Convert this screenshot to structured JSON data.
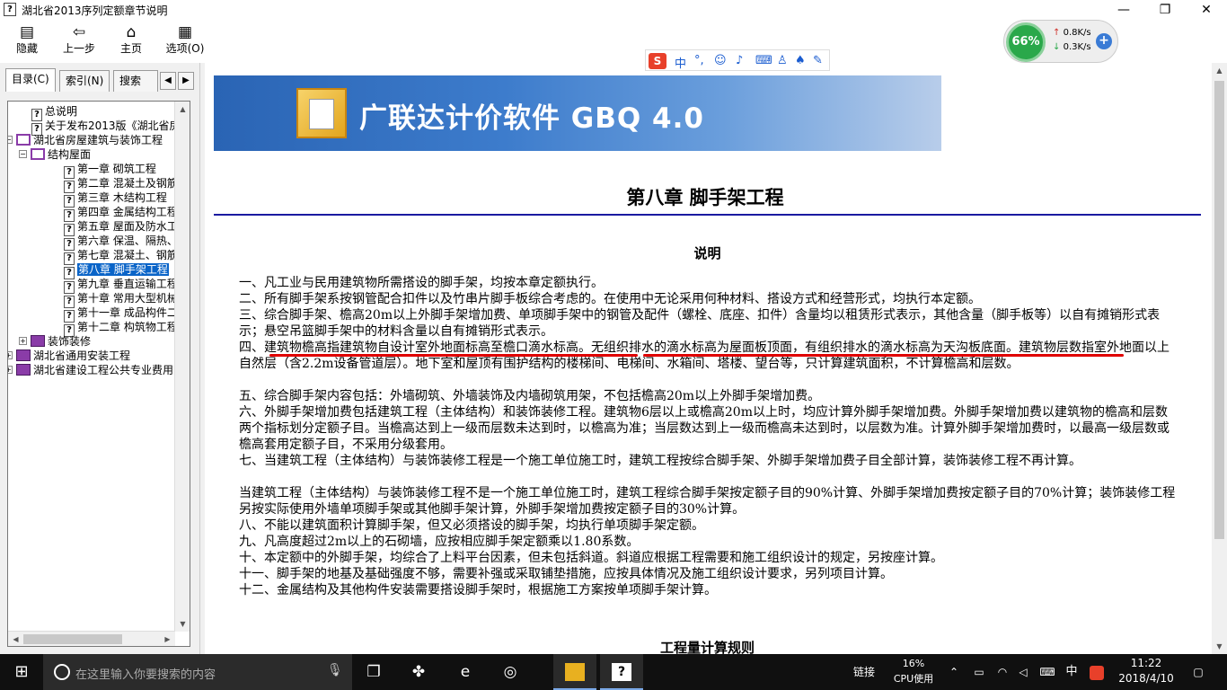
{
  "window": {
    "title": "湖北省2013序列定额章节说明",
    "minimize": "—",
    "maximize": "❐",
    "close": "✕"
  },
  "toolbar": {
    "hide": "隐藏",
    "back": "上一步",
    "home": "主页",
    "options": "选项(O)"
  },
  "left_tabs": {
    "contents": "目录(C)",
    "index": "索引(N)",
    "search": "搜索(S)"
  },
  "tree": [
    {
      "label": "总说明",
      "type": "page",
      "level": 1
    },
    {
      "label": "关于发布2013版《湖北省房屋",
      "type": "page",
      "level": 1
    },
    {
      "label": "湖北省房屋建筑与装饰工程",
      "type": "book-open",
      "level": 0,
      "expander": "−"
    },
    {
      "label": "结构屋面",
      "type": "book-open",
      "level": 1,
      "expander": "−"
    },
    {
      "label": "第一章 砌筑工程",
      "type": "page",
      "level": 2
    },
    {
      "label": "第二章 混凝土及钢筋",
      "type": "page",
      "level": 2
    },
    {
      "label": "第三章 木结构工程",
      "type": "page",
      "level": 2
    },
    {
      "label": "第四章 金属结构工程",
      "type": "page",
      "level": 2
    },
    {
      "label": "第五章 屋面及防水工程",
      "type": "page",
      "level": 2
    },
    {
      "label": "第六章 保温、隔热、防",
      "type": "page",
      "level": 2
    },
    {
      "label": "第七章 混凝土、钢筋",
      "type": "page",
      "level": 2
    },
    {
      "label": "第八章 脚手架工程",
      "type": "page",
      "level": 2,
      "selected": true
    },
    {
      "label": "第九章 垂直运输工程",
      "type": "page",
      "level": 2
    },
    {
      "label": "第十章 常用大型机械",
      "type": "page",
      "level": 2
    },
    {
      "label": "第十一章 成品构件二次",
      "type": "page",
      "level": 2
    },
    {
      "label": "第十二章 构筑物工程",
      "type": "page",
      "level": 2
    },
    {
      "label": "装饰装修",
      "type": "book",
      "level": 1,
      "expander": "+"
    },
    {
      "label": "湖北省通用安装工程",
      "type": "book",
      "level": 0,
      "expander": "+"
    },
    {
      "label": "湖北省建设工程公共专业费用",
      "type": "book",
      "level": 0,
      "expander": "+"
    }
  ],
  "banner": {
    "text": "广联达计价软件 GBQ 4.0"
  },
  "content": {
    "chapter_title": "第八章 脚手架工程",
    "section_title": "说明",
    "paragraphs": [
      "一、凡工业与民用建筑物所需搭设的脚手架，均按本章定额执行。",
      "二、所有脚手架系按钢管配合扣件以及竹串片脚手板综合考虑的。在使用中无论采用何种材料、搭设方式和经营形式，均执行本定额。",
      "三、综合脚手架、檐高20m以上外脚手架增加费、单项脚手架中的钢管及配件（螺栓、底座、扣件）含量均以租赁形式表示，其他含量（脚手板等）以自有摊销形式表示；悬空吊篮脚手架中的材料含量以自有摊销形式表示。",
      "四、建筑物檐高指建筑物自设计室外地面标高至檐口滴水标高。无组织排水的滴水标高为屋面板顶面，有组织排水的滴水标高为天沟板底面。建筑物层数指室外地面以上自然层（含2.2m设备管道层）。地下室和屋顶有围护结构的楼梯间、电梯间、水箱间、塔楼、望台等，只计算建筑面积，不计算檐高和层数。",
      "五、综合脚手架内容包括：外墙砌筑、外墙装饰及内墙砌筑用架，不包括檐高20m以上外脚手架增加费。",
      "六、外脚手架增加费包括建筑工程（主体结构）和装饰装修工程。建筑物6层以上或檐高20m以上时，均应计算外脚手架增加费。外脚手架增加费以建筑物的檐高和层数两个指标划分定额子目。当檐高达到上一级而层数未达到时，以檐高为准；当层数达到上一级而檐高未达到时，以层数为准。计算外脚手架增加费时，以最高一级层数或檐高套用定额子目，不采用分级套用。",
      "七、当建筑工程（主体结构）与装饰装修工程是一个施工单位施工时，建筑工程按综合脚手架、外脚手架增加费子目全部计算，装饰装修工程不再计算。",
      "当建筑工程（主体结构）与装饰装修工程不是一个施工单位施工时，建筑工程综合脚手架按定额子目的90%计算、外脚手架增加费按定额子目的70%计算；装饰装修工程另按实际使用外墙单项脚手架或其他脚手架计算，外脚手架增加费按定额子目的30%计算。",
      "八、不能以建筑面积计算脚手架，但又必须搭设的脚手架，均执行单项脚手架定额。",
      "九、凡高度超过2m以上的石砌墙，应按相应脚手架定额乘以1.80系数。",
      "十、本定额中的外脚手架，均综合了上料平台因素，但未包括斜道。斜道应根据工程需要和施工组织设计的规定，另按座计算。",
      "十一、脚手架的地基及基础强度不够，需要补强或采取铺垫措施，应按具体情况及施工组织设计要求，另列项目计算。",
      "十二、金属结构及其他构件安装需要搭设脚手架时，根据施工方案按单项脚手架计算。"
    ],
    "next_section_title": "工程量计算规则"
  },
  "ime": {
    "logo": "S",
    "mode": "中"
  },
  "net_widget": {
    "percent": "66%",
    "upload": "0.8K/s",
    "download": "0.3K/s"
  },
  "taskbar": {
    "search_placeholder": "在这里输入你要搜索的内容",
    "link_label": "链接",
    "cpu_percent": "16%",
    "cpu_label": "CPU使用",
    "lang": "中",
    "time": "11:22",
    "date": "2018/4/10"
  }
}
